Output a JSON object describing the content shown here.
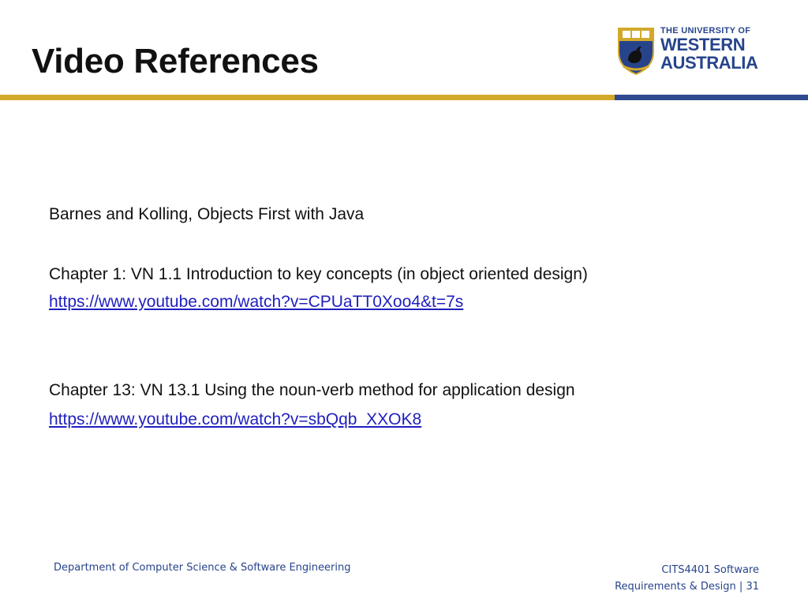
{
  "slide": {
    "title": "Video References"
  },
  "logo": {
    "line1": "THE UNIVERSITY OF",
    "line2": "WESTERN",
    "line3": "AUSTRALIA",
    "brand_blue": "#27448b",
    "brand_gold": "#d2a92b"
  },
  "body": {
    "book": "Barnes and Kolling, Objects First with Java",
    "items": [
      {
        "chapter": "Chapter 1: VN 1.1 Introduction to key concepts (in object oriented design)",
        "url": "https://www.youtube.com/watch?v=CPUaTT0Xoo4&t=7s"
      },
      {
        "chapter": "Chapter 13: VN 13.1 Using the noun-verb method for application design",
        "url": "https://www.youtube.com/watch?v=sbQqb_XXOK8"
      }
    ]
  },
  "footer": {
    "department": "Department of Computer Science & Software Engineering",
    "course_line1": "CITS4401 Software",
    "course_line2": "Requirements & Design",
    "separator": "|",
    "page_number": "31"
  },
  "colors": {
    "title_text": "#111111",
    "rule_gold": "#d2a92b",
    "rule_blue": "#2f4a8f",
    "link": "#1f1fbf",
    "footer_text": "#27448b"
  }
}
